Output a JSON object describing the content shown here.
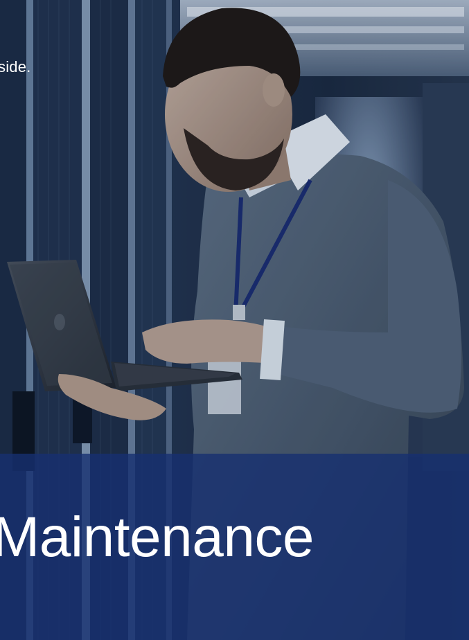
{
  "hero": {
    "cropped_text": "side.",
    "banner_title": "Maintenance"
  },
  "colors": {
    "background": "#0b1526",
    "banner_overlay": "#163070",
    "text": "#ffffff"
  }
}
